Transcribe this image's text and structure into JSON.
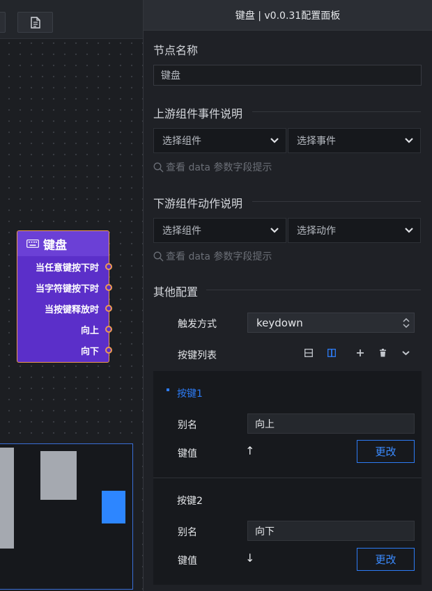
{
  "canvas": {
    "node": {
      "title": "键盘",
      "ports": [
        "当任意键按下时",
        "当字符键按下时",
        "当按键释放时",
        "向上",
        "向下"
      ]
    }
  },
  "panel": {
    "header": "键盘 | v0.0.31配置面板",
    "node_name_label": "节点名称",
    "node_name_value": "键盘",
    "upstream_title": "上游组件事件说明",
    "upstream_component_placeholder": "选择组件",
    "upstream_event_placeholder": "选择事件",
    "upstream_hint": "查看 data 参数字段提示",
    "downstream_title": "下游组件动作说明",
    "downstream_component_placeholder": "选择组件",
    "downstream_action_placeholder": "选择动作",
    "downstream_hint": "查看 data 参数字段提示",
    "other_title": "其他配置",
    "trigger_label": "触发方式",
    "trigger_value": "keydown",
    "key_list_label": "按键列表",
    "keys": [
      {
        "title": "按键1",
        "alias_label": "别名",
        "alias_value": "向上",
        "value_label": "键值",
        "key_symbol": "↑",
        "change_label": "更改"
      },
      {
        "title": "按键2",
        "alias_label": "别名",
        "alias_value": "向下",
        "value_label": "键值",
        "key_symbol": "↓",
        "change_label": "更改"
      }
    ]
  },
  "colors": {
    "accent": "#2d7cf6",
    "node_bg": "#5b2fc9",
    "node_border": "#ee9a54"
  }
}
